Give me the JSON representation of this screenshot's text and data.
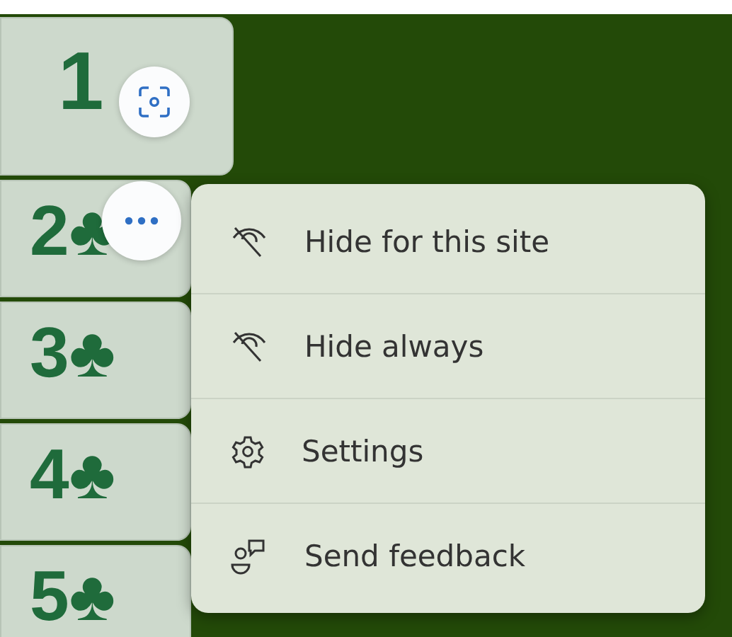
{
  "cards": [
    {
      "label": "1"
    },
    {
      "label": "2♣"
    },
    {
      "label": "3♣"
    },
    {
      "label": "4♣"
    },
    {
      "label": "5♣"
    }
  ],
  "menu": {
    "items": [
      {
        "kind": "hide",
        "label": "Hide for this site"
      },
      {
        "kind": "hide",
        "label": "Hide always"
      },
      {
        "kind": "settings",
        "label": "Settings"
      },
      {
        "kind": "feedback",
        "label": "Send feedback"
      }
    ]
  }
}
